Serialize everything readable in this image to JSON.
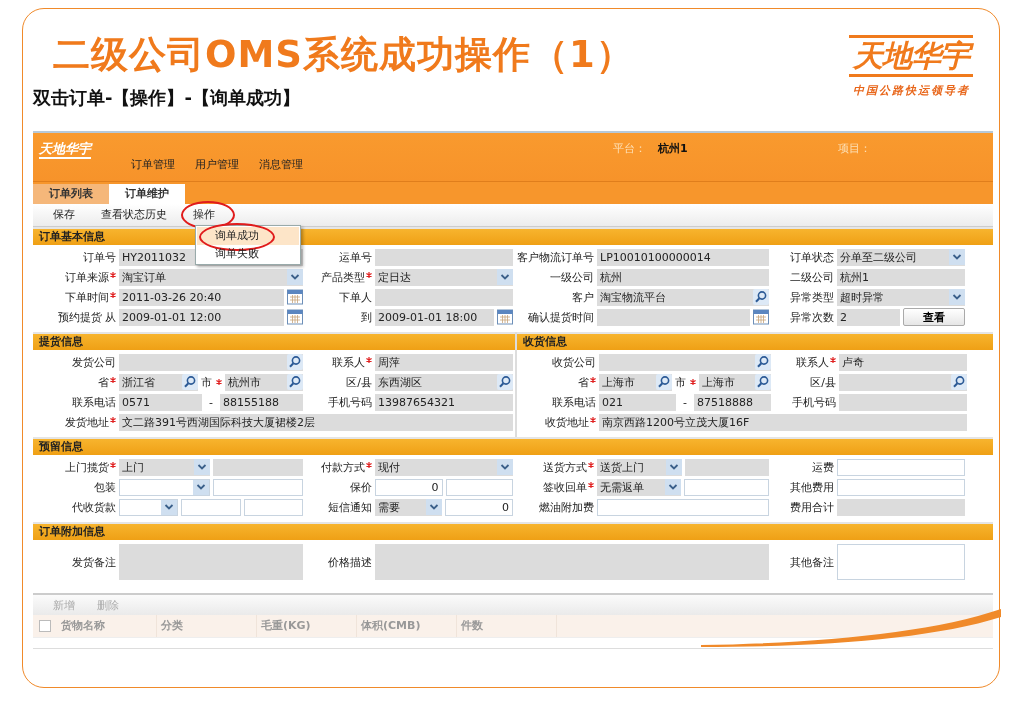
{
  "slide": {
    "title": "二级公司OMS系统成功操作（1）",
    "subtitle": "双击订单-【操作】-【询单成功】",
    "logo": {
      "brand": "天地华宇",
      "slogan": "中国公路快运领导者"
    }
  },
  "app": {
    "logo": "天地华宇",
    "nav": [
      {
        "label": "订单管理"
      },
      {
        "label": "用户管理"
      },
      {
        "label": "消息管理"
      }
    ],
    "platform": {
      "label": "平台：",
      "value": "杭州1"
    },
    "project": {
      "label": "项目："
    },
    "tabs": [
      {
        "label": "订单列表",
        "selected": false
      },
      {
        "label": "订单维护",
        "selected": true
      }
    ],
    "toolbar": [
      {
        "label": "保存",
        "circled": false
      },
      {
        "label": "查看状态历史",
        "circled": false
      },
      {
        "label": "操作",
        "circled": true,
        "menu": [
          {
            "label": "询单成功",
            "selected": true,
            "circled": true
          },
          {
            "label": "询单失败",
            "selected": false,
            "circled": false
          }
        ]
      }
    ],
    "panels": [
      [
        {
          "title": "订单基本信息",
          "rows": [
            [
              {
                "label": "订单号",
                "parts": [
                  {
                    "kind": "text",
                    "readonly": true,
                    "value": "HY2011032"
                  }
                ]
              },
              {
                "label": "运单号",
                "parts": [
                  {
                    "kind": "text",
                    "readonly": true
                  }
                ]
              },
              {
                "label": "客户物流订单号",
                "parts": [
                  {
                    "kind": "text",
                    "readonly": true,
                    "value": "LP10010100000014"
                  }
                ]
              },
              {
                "label": "订单状态",
                "parts": [
                  {
                    "kind": "select",
                    "readonly": true,
                    "value": "分单至二级公司"
                  }
                ]
              }
            ],
            [
              {
                "label": "订单来源",
                "required": true,
                "parts": [
                  {
                    "kind": "select",
                    "readonly": true,
                    "value": "淘宝订单"
                  }
                ]
              },
              {
                "label": "产品类型",
                "required": true,
                "parts": [
                  {
                    "kind": "select",
                    "readonly": true,
                    "value": "定日达"
                  }
                ]
              },
              {
                "label": "一级公司",
                "parts": [
                  {
                    "kind": "text",
                    "readonly": true,
                    "value": "杭州"
                  }
                ]
              },
              {
                "label": "二级公司",
                "parts": [
                  {
                    "kind": "text",
                    "readonly": true,
                    "value": "杭州1"
                  }
                ]
              }
            ],
            [
              {
                "label": "下单时间",
                "required": true,
                "parts": [
                  {
                    "kind": "date",
                    "readonly": true,
                    "value": "2011-03-26 20:40"
                  }
                ]
              },
              {
                "label": "下单人",
                "parts": [
                  {
                    "kind": "text",
                    "readonly": true
                  }
                ]
              },
              {
                "label": "客户",
                "parts": [
                  {
                    "kind": "lookup",
                    "readonly": true,
                    "value": "淘宝物流平台"
                  }
                ]
              },
              {
                "label": "异常类型",
                "parts": [
                  {
                    "kind": "select",
                    "readonly": true,
                    "value": "超时异常"
                  }
                ]
              }
            ],
            [
              {
                "label": "预约提货 从",
                "parts": [
                  {
                    "kind": "date",
                    "readonly": true,
                    "value": "2009-01-01 12:00"
                  }
                ]
              },
              {
                "label": "到",
                "parts": [
                  {
                    "kind": "date",
                    "readonly": true,
                    "value": "2009-01-01 18:00"
                  }
                ]
              },
              {
                "label": "确认提货时间",
                "parts": [
                  {
                    "kind": "date",
                    "readonly": true
                  }
                ]
              },
              {
                "label": "异常次数",
                "parts": [
                  {
                    "kind": "text",
                    "readonly": true,
                    "value": "2"
                  },
                  {
                    "kind": "button",
                    "value": "查看"
                  }
                ]
              }
            ]
          ]
        }
      ],
      [
        {
          "title": "提货信息",
          "rows": [
            [
              {
                "label": "发货公司",
                "parts": [
                  {
                    "kind": "lookup",
                    "readonly": true
                  }
                ]
              },
              {
                "label": "联系人",
                "required": true,
                "parts": [
                  {
                    "kind": "text",
                    "readonly": true,
                    "value": "周萍"
                  }
                ]
              }
            ],
            [
              {
                "label": "省",
                "required": true,
                "parts": [
                  {
                    "kind": "lookup",
                    "readonly": true,
                    "value": "浙江省"
                  },
                  {
                    "kind": "sublabel",
                    "required": true,
                    "value": "市"
                  },
                  {
                    "kind": "lookup",
                    "readonly": true,
                    "value": "杭州市"
                  }
                ]
              },
              {
                "label": "区/县",
                "parts": [
                  {
                    "kind": "lookup",
                    "readonly": true,
                    "value": "东西湖区"
                  }
                ]
              }
            ],
            [
              {
                "label": "联系电话",
                "parts": [
                  {
                    "kind": "text",
                    "readonly": true,
                    "value": "0571"
                  },
                  {
                    "kind": "dash",
                    "value": "-"
                  },
                  {
                    "kind": "text",
                    "readonly": true,
                    "value": "88155188"
                  }
                ]
              },
              {
                "label": "手机号码",
                "parts": [
                  {
                    "kind": "text",
                    "readonly": true,
                    "value": "13987654321"
                  }
                ]
              }
            ],
            [
              {
                "label": "发货地址",
                "required": true,
                "wide": true,
                "parts": [
                  {
                    "kind": "text",
                    "readonly": true,
                    "value": "文二路391号西湖国际科技大厦裙楼2层"
                  }
                ]
              }
            ]
          ]
        },
        {
          "title": "收货信息",
          "rows": [
            [
              {
                "label": "收货公司",
                "parts": [
                  {
                    "kind": "lookup",
                    "readonly": true
                  }
                ]
              },
              {
                "label": "联系人",
                "required": true,
                "parts": [
                  {
                    "kind": "text",
                    "readonly": true,
                    "value": "卢奇"
                  }
                ]
              }
            ],
            [
              {
                "label": "省",
                "required": true,
                "parts": [
                  {
                    "kind": "lookup",
                    "readonly": true,
                    "value": "上海市"
                  },
                  {
                    "kind": "sublabel",
                    "required": true,
                    "value": "市"
                  },
                  {
                    "kind": "lookup",
                    "readonly": true,
                    "value": "上海市"
                  }
                ]
              },
              {
                "label": "区/县",
                "parts": [
                  {
                    "kind": "lookup",
                    "readonly": true
                  }
                ]
              }
            ],
            [
              {
                "label": "联系电话",
                "parts": [
                  {
                    "kind": "text",
                    "readonly": true,
                    "value": "021"
                  },
                  {
                    "kind": "dash",
                    "value": "-"
                  },
                  {
                    "kind": "text",
                    "readonly": true,
                    "value": "87518888"
                  }
                ]
              },
              {
                "label": "手机号码",
                "parts": [
                  {
                    "kind": "text",
                    "readonly": true
                  }
                ]
              }
            ],
            [
              {
                "label": "收货地址",
                "required": true,
                "wide": true,
                "parts": [
                  {
                    "kind": "text",
                    "readonly": true,
                    "value": "南京西路1200号立茂大厦16F"
                  }
                ]
              }
            ]
          ]
        }
      ],
      [
        {
          "title": "预留信息",
          "rows": [
            [
              {
                "label": "上门揽货",
                "required": true,
                "parts": [
                  {
                    "kind": "select",
                    "readonly": true,
                    "value": "上门"
                  },
                  {
                    "kind": "text",
                    "readonly": true
                  }
                ]
              },
              {
                "label": "付款方式",
                "required": true,
                "parts": [
                  {
                    "kind": "select",
                    "readonly": true,
                    "value": "现付"
                  }
                ]
              },
              {
                "label": "送货方式",
                "required": true,
                "parts": [
                  {
                    "kind": "select",
                    "readonly": true,
                    "value": "送货上门"
                  },
                  {
                    "kind": "text",
                    "readonly": true
                  }
                ]
              },
              {
                "label": "运费",
                "parts": [
                  {
                    "kind": "text",
                    "readonly": false
                  }
                ]
              }
            ],
            [
              {
                "label": "包装",
                "parts": [
                  {
                    "kind": "select",
                    "readonly": false
                  },
                  {
                    "kind": "text",
                    "readonly": false
                  }
                ]
              },
              {
                "label": "保价",
                "parts": [
                  {
                    "kind": "number",
                    "readonly": false,
                    "value": "0"
                  },
                  {
                    "kind": "text",
                    "readonly": false
                  }
                ]
              },
              {
                "label": "签收回单",
                "required": true,
                "parts": [
                  {
                    "kind": "select",
                    "readonly": true,
                    "value": "无需返单"
                  },
                  {
                    "kind": "text",
                    "readonly": false
                  }
                ]
              },
              {
                "label": "其他费用",
                "parts": [
                  {
                    "kind": "text",
                    "readonly": false
                  }
                ]
              }
            ],
            [
              {
                "label": "代收货款",
                "parts": [
                  {
                    "kind": "select",
                    "readonly": false
                  },
                  {
                    "kind": "text",
                    "readonly": false
                  },
                  {
                    "kind": "text",
                    "readonly": false
                  }
                ]
              },
              {
                "label": "短信通知",
                "parts": [
                  {
                    "kind": "select",
                    "readonly": true,
                    "value": "需要"
                  },
                  {
                    "kind": "number",
                    "readonly": false,
                    "value": "0"
                  }
                ]
              },
              {
                "label": "燃油附加费",
                "parts": [
                  {
                    "kind": "text",
                    "readonly": false
                  }
                ]
              },
              {
                "label": "费用合计",
                "parts": [
                  {
                    "kind": "text",
                    "readonly": true
                  }
                ]
              }
            ]
          ]
        }
      ],
      [
        {
          "title": "订单附加信息",
          "rows": [
            [
              {
                "label": "发货备注",
                "parts": [
                  {
                    "kind": "textarea",
                    "readonly": true
                  }
                ]
              },
              {
                "label": "价格描述",
                "wide": true,
                "parts": [
                  {
                    "kind": "textarea",
                    "readonly": true
                  }
                ]
              },
              {
                "label": "其他备注",
                "parts": [
                  {
                    "kind": "textarea",
                    "readonly": false
                  }
                ]
              }
            ]
          ]
        }
      ]
    ],
    "grid": {
      "select_all": {
        "checked": false
      },
      "actions": [
        {
          "label": "新增",
          "disabled": true
        },
        {
          "label": "删除",
          "disabled": true
        }
      ],
      "columns": [
        "货物名称",
        "分类",
        "毛重(KG)",
        "体积(CMB)",
        "件数"
      ]
    }
  }
}
